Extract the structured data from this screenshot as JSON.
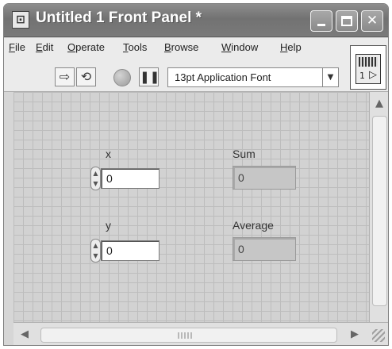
{
  "window": {
    "title": "Untitled 1 Front Panel *",
    "app_icon": "front-panel-icon"
  },
  "menubar": {
    "items": [
      "File",
      "Edit",
      "Operate",
      "Tools",
      "Browse",
      "Window",
      "Help"
    ]
  },
  "toolbar": {
    "run_icon": "run-arrow-icon",
    "run_continuously_icon": "run-continuously-icon",
    "abort_icon": "abort-execution-icon",
    "pause_icon": "pause-icon",
    "font_select_value": "13pt Application Font",
    "connector_pane_number": "1"
  },
  "panel": {
    "controls": [
      {
        "label": "x",
        "value": "0"
      },
      {
        "label": "y",
        "value": "0"
      }
    ],
    "indicators": [
      {
        "label": "Sum",
        "value": "0"
      },
      {
        "label": "Average",
        "value": "0"
      }
    ]
  },
  "colors": {
    "titlebar": "#7a7a7a",
    "panel_background": "#d2d2d2",
    "grid_lines": "#bdbdbd",
    "control_background": "#ffffff",
    "indicator_background": "#c6c6c6"
  }
}
